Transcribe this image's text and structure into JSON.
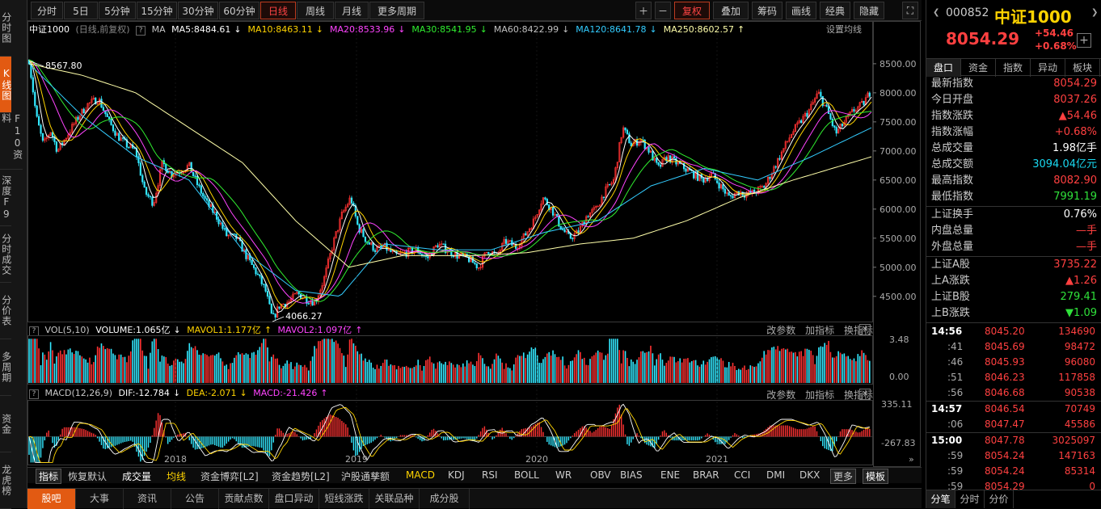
{
  "left_nav": [
    {
      "id": "fenshi",
      "label": "分时图"
    },
    {
      "id": "kline",
      "label": "K线图",
      "active": true
    },
    {
      "id": "f10",
      "label": "F10资料"
    },
    {
      "id": "depth",
      "label": "深度F9"
    },
    {
      "id": "fenshi-deal",
      "label": "分时成交"
    },
    {
      "id": "price-table",
      "label": "分价表"
    },
    {
      "id": "multi",
      "label": "多周期"
    },
    {
      "id": "fund",
      "label": "资金"
    },
    {
      "id": "dragon",
      "label": "龙虎榜"
    }
  ],
  "toolbar": {
    "periods": [
      "分时",
      "5日",
      "5分钟",
      "15分钟",
      "30分钟",
      "60分钟",
      "日线",
      "周线",
      "月线",
      "更多周期"
    ],
    "active_period": "日线",
    "right_buttons": [
      "＋",
      "－",
      "复权",
      "叠加",
      "筹码",
      "画线",
      "经典",
      "隐藏"
    ],
    "active_right": "复权"
  },
  "main_chart": {
    "name": "中证1000",
    "mode": "(日线,前复权)",
    "ma_label": "MA",
    "ma_items": [
      {
        "text": "MA5:8484.61",
        "arrow": "↓",
        "color": "#ffffff",
        "arrow_color": "#ffffff"
      },
      {
        "text": "MA10:8463.11",
        "arrow": "↓",
        "color": "#ffd400",
        "arrow_color": "#ffd400"
      },
      {
        "text": "MA20:8533.96",
        "arrow": "↓",
        "color": "#ff44ff",
        "arrow_color": "#ff44ff"
      },
      {
        "text": "MA30:8541.95",
        "arrow": "↓",
        "color": "#30ee30",
        "arrow_color": "#30ee30"
      },
      {
        "text": "MA60:8422.99",
        "arrow": "↓",
        "color": "#c0c0c0",
        "arrow_color": "#c0c0c0"
      },
      {
        "text": "MA120:8641.78",
        "arrow": "↓",
        "color": "#33ccff",
        "arrow_color": "#33ccff"
      },
      {
        "text": "MA250:8602.57",
        "arrow": "↑",
        "color": "#ffffaa",
        "arrow_color": "#ffffaa"
      }
    ],
    "settings": "设置均线",
    "y_ticks": [
      "8500.00",
      "8000.00",
      "7500.00",
      "7000.00",
      "6500.00",
      "6000.00",
      "5500.00",
      "5000.00",
      "4500.00"
    ],
    "high_annotation": "8567.80",
    "low_annotation": "4066.27",
    "x_labels": [
      "2018",
      "2019",
      "2020",
      "2021"
    ]
  },
  "vol_panel": {
    "title": "VOL(5,10)",
    "volume": "VOLUME:1.065亿",
    "volume_arrow": "↓",
    "mavol1": "MAVOL1:1.177亿",
    "mavol1_arrow": "↑",
    "mavol2": "MAVOL2:1.097亿",
    "mavol2_arrow": "↑",
    "tools": [
      "改参数",
      "加指标",
      "换指标"
    ],
    "y_ticks": [
      "3.48",
      "0.00"
    ]
  },
  "macd_panel": {
    "title": "MACD(12,26,9)",
    "dif": "DIF:-12.784",
    "dif_arrow": "↓",
    "dea": "DEA:-2.071",
    "dea_arrow": "↓",
    "macd": "MACD:-21.426",
    "macd_arrow": "↑",
    "tools": [
      "改参数",
      "加指标",
      "换指标"
    ],
    "y_ticks": [
      "335.11",
      "-267.83"
    ]
  },
  "indicator_bar": [
    "指标",
    "恢复默认",
    "成交量",
    "均线",
    "资金博弈[L2]",
    "资金趋势[L2]",
    "沪股通孳额",
    "MACD",
    "KDJ",
    "RSI",
    "BOLL",
    "WR",
    "OBV",
    "BIAS",
    "ENE",
    "BRAR",
    "CCI",
    "DMI",
    "DKX",
    "更多",
    "模板"
  ],
  "bottom_tabs": [
    "股吧",
    "大事",
    "资讯",
    "公告",
    "贡献点数",
    "盘口异动",
    "短线涨跌",
    "关联品种",
    "成分股"
  ],
  "right_panel": {
    "code": "000852",
    "name": "中证1000",
    "price": "8054.29",
    "change": "+54.46",
    "change_pct": "+0.68%",
    "add_icon": "plus-icon",
    "tabs": [
      "盘口",
      "资金",
      "指数",
      "异动",
      "板块"
    ],
    "active_tab": "盘口",
    "stats1": [
      {
        "label": "最新指数",
        "value": "8054.29",
        "cls": "red"
      },
      {
        "label": "今日开盘",
        "value": "8037.26",
        "cls": "red"
      },
      {
        "label": "指数涨跌",
        "value": "▲54.46",
        "cls": "red"
      },
      {
        "label": "指数涨幅",
        "value": "+0.68%",
        "cls": "red"
      },
      {
        "label": "总成交量",
        "value": "1.98亿手",
        "cls": "white"
      },
      {
        "label": "总成交额",
        "value": "3094.04亿元",
        "cls": "cyan"
      },
      {
        "label": "最高指数",
        "value": "8082.90",
        "cls": "red"
      },
      {
        "label": "最低指数",
        "value": "7991.19",
        "cls": "green"
      }
    ],
    "stats2": [
      {
        "label": "上证换手",
        "value": "0.76%",
        "cls": "white"
      },
      {
        "label": "内盘总量",
        "value": "—手",
        "cls": "red"
      },
      {
        "label": "外盘总量",
        "value": "—手",
        "cls": "red"
      }
    ],
    "stats3": [
      {
        "label": "上证A股",
        "value": "3735.22",
        "cls": "red"
      },
      {
        "label": "上A涨跌",
        "value": "▲1.26",
        "cls": "red"
      },
      {
        "label": "上证B股",
        "value": "279.41",
        "cls": "green"
      },
      {
        "label": "上B涨跌",
        "value": "▼1.09",
        "cls": "green"
      }
    ],
    "ticks": [
      {
        "time": "14:56",
        "price": "8045.20",
        "vol": "134690",
        "bold": true
      },
      {
        "time": ":41",
        "price": "8045.69",
        "vol": "98472"
      },
      {
        "time": ":46",
        "price": "8045.93",
        "vol": "96080"
      },
      {
        "time": ":51",
        "price": "8046.23",
        "vol": "117858"
      },
      {
        "time": ":56",
        "price": "8046.68",
        "vol": "90538"
      },
      {
        "time": "14:57",
        "price": "8046.54",
        "vol": "70749",
        "bold": true
      },
      {
        "time": ":06",
        "price": "8047.47",
        "vol": "45586"
      },
      {
        "time": "15:00",
        "price": "8047.78",
        "vol": "3025097",
        "bold": true
      },
      {
        "time": ":59",
        "price": "8054.24",
        "vol": "147163"
      },
      {
        "time": ":59",
        "price": "8054.24",
        "vol": "85314"
      },
      {
        "time": ":59",
        "price": "8054.29",
        "vol": "0"
      }
    ],
    "bottom_tabs": [
      "分笔",
      "分时",
      "分价"
    ],
    "active_bottom": "分笔"
  },
  "chart_data": {
    "type": "candlestick",
    "title": "中证1000 (日线,前复权)",
    "x_labels": [
      "2018",
      "2019",
      "2020",
      "2021"
    ],
    "ylim": [
      4066.27,
      8567.8
    ],
    "y_ticks": [
      4500,
      5000,
      5500,
      6000,
      6500,
      7000,
      7500,
      8000,
      8500
    ],
    "high": 8567.8,
    "low": 4066.27,
    "last": 8054.29,
    "price_path": [
      [
        0,
        8567.8
      ],
      [
        8,
        7600
      ],
      [
        16,
        7100
      ],
      [
        24,
        7350
      ],
      [
        32,
        7000
      ],
      [
        44,
        7300
      ],
      [
        56,
        7600
      ],
      [
        66,
        7800
      ],
      [
        78,
        7900
      ],
      [
        90,
        7500
      ],
      [
        100,
        7250
      ],
      [
        110,
        7100
      ],
      [
        120,
        7000
      ],
      [
        130,
        6300
      ],
      [
        140,
        6100
      ],
      [
        150,
        6800
      ],
      [
        160,
        6600
      ],
      [
        170,
        6650
      ],
      [
        180,
        6750
      ],
      [
        190,
        6400
      ],
      [
        200,
        6100
      ],
      [
        210,
        5900
      ],
      [
        222,
        5550
      ],
      [
        234,
        5500
      ],
      [
        244,
        5200
      ],
      [
        256,
        4900
      ],
      [
        266,
        4600
      ],
      [
        274,
        4100
      ],
      [
        282,
        4350
      ],
      [
        292,
        4400
      ],
      [
        302,
        4550
      ],
      [
        312,
        4450
      ],
      [
        322,
        4400
      ],
      [
        332,
        4800
      ],
      [
        342,
        5400
      ],
      [
        352,
        5900
      ],
      [
        362,
        6200
      ],
      [
        370,
        5700
      ],
      [
        380,
        5450
      ],
      [
        390,
        5300
      ],
      [
        400,
        5350
      ],
      [
        412,
        5200
      ],
      [
        424,
        5250
      ],
      [
        436,
        5300
      ],
      [
        448,
        5150
      ],
      [
        460,
        5400
      ],
      [
        470,
        5300
      ],
      [
        482,
        5200
      ],
      [
        494,
        5150
      ],
      [
        506,
        5000
      ],
      [
        516,
        5300
      ],
      [
        526,
        5200
      ],
      [
        536,
        5450
      ],
      [
        548,
        5350
      ],
      [
        558,
        5550
      ],
      [
        568,
        5800
      ],
      [
        578,
        6200
      ],
      [
        588,
        6000
      ],
      [
        598,
        5700
      ],
      [
        608,
        5500
      ],
      [
        618,
        5600
      ],
      [
        628,
        5900
      ],
      [
        638,
        6000
      ],
      [
        648,
        6300
      ],
      [
        658,
        6500
      ],
      [
        668,
        7400
      ],
      [
        678,
        7100
      ],
      [
        688,
        7200
      ],
      [
        698,
        7000
      ],
      [
        708,
        6700
      ],
      [
        718,
        6900
      ],
      [
        728,
        6800
      ],
      [
        738,
        6700
      ],
      [
        748,
        6600
      ],
      [
        758,
        6500
      ],
      [
        768,
        6600
      ],
      [
        778,
        6400
      ],
      [
        788,
        6200
      ],
      [
        798,
        6300
      ],
      [
        808,
        6250
      ],
      [
        818,
        6300
      ],
      [
        828,
        6400
      ],
      [
        838,
        6700
      ],
      [
        848,
        7000
      ],
      [
        858,
        7300
      ],
      [
        868,
        7500
      ],
      [
        878,
        7700
      ],
      [
        888,
        8000
      ],
      [
        898,
        7700
      ],
      [
        908,
        7300
      ],
      [
        918,
        7500
      ],
      [
        928,
        7700
      ],
      [
        938,
        7800
      ],
      [
        948,
        8054.29
      ]
    ],
    "ma_paths": {
      "ma120": [
        [
          0,
          8500
        ],
        [
          60,
          7600
        ],
        [
          120,
          6900
        ],
        [
          180,
          6500
        ],
        [
          240,
          5300
        ],
        [
          300,
          4600
        ],
        [
          350,
          4500
        ],
        [
          400,
          5400
        ],
        [
          460,
          5300
        ],
        [
          520,
          5300
        ],
        [
          580,
          5600
        ],
        [
          640,
          5800
        ],
        [
          700,
          6400
        ],
        [
          760,
          6700
        ],
        [
          820,
          6500
        ],
        [
          880,
          6900
        ],
        [
          948,
          7400
        ]
      ],
      "ma250": [
        [
          0,
          8500
        ],
        [
          60,
          8300
        ],
        [
          120,
          8000
        ],
        [
          180,
          7400
        ],
        [
          240,
          6800
        ],
        [
          300,
          5800
        ],
        [
          360,
          5000
        ],
        [
          420,
          5200
        ],
        [
          500,
          5200
        ],
        [
          560,
          5250
        ],
        [
          620,
          5400
        ],
        [
          680,
          5500
        ],
        [
          740,
          5800
        ],
        [
          800,
          6200
        ],
        [
          860,
          6500
        ],
        [
          948,
          6900
        ]
      ]
    },
    "volume": {
      "ylim": [
        0,
        3.48
      ],
      "unit": "亿",
      "last": 1.065
    },
    "macd": {
      "ylim": [
        -267.83,
        335.11
      ],
      "dif": -12.784,
      "dea": -2.071,
      "macd": -21.426
    }
  }
}
